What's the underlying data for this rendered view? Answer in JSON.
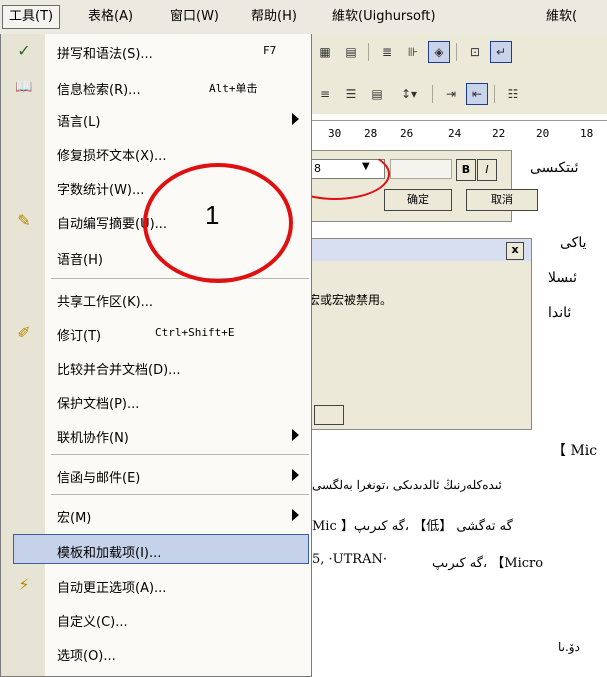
{
  "menubar": {
    "items": [
      "工具(T)",
      "表格(A)",
      "窗口(W)",
      "帮助(H)",
      "維软(Uighursoft)",
      "維软("
    ]
  },
  "ruler": {
    "ticks": [
      "30",
      "28",
      "26",
      "24",
      "22",
      "20",
      "18"
    ]
  },
  "dialog1": {
    "ok": "确定",
    "cancel": "取消",
    "bold": "B",
    "italic": "I",
    "fontsize": "8"
  },
  "dialog2": {
    "text": "宏或宏被禁用。",
    "close": "x"
  },
  "annotation": {
    "number": "1"
  },
  "menu": {
    "items": [
      {
        "label": "拼写和语法(S)...",
        "shortcut": "F7",
        "icon": "spellcheck-icon",
        "glyph": "✓"
      },
      {
        "label": "信息检索(R)...",
        "shortcut": "Alt+单击",
        "icon": "research-icon",
        "glyph": "📖"
      },
      {
        "label": "语言(L)",
        "icon": "",
        "glyph": ""
      },
      {
        "label": "修复损坏文本(X)...",
        "icon": "",
        "glyph": ""
      },
      {
        "label": "字数统计(W)...",
        "icon": "",
        "glyph": ""
      },
      {
        "label": "自动编写摘要(U)...",
        "icon": "autosummary-icon",
        "glyph": "✎"
      },
      {
        "label": "语音(H)",
        "icon": "",
        "glyph": ""
      },
      {
        "label": "共享工作区(K)...",
        "icon": "",
        "glyph": ""
      },
      {
        "label": "修订(T)",
        "shortcut": "Ctrl+Shift+E",
        "icon": "track-changes-icon",
        "glyph": "✐"
      },
      {
        "label": "比较并合并文档(D)...",
        "icon": "",
        "glyph": ""
      },
      {
        "label": "保护文档(P)...",
        "icon": "",
        "glyph": ""
      },
      {
        "label": "联机协作(N)",
        "icon": "",
        "glyph": ""
      },
      {
        "label": "信函与邮件(E)",
        "icon": "",
        "glyph": ""
      },
      {
        "label": "宏(M)",
        "icon": "",
        "glyph": ""
      },
      {
        "label": "模板和加载项(I)...",
        "icon": "",
        "glyph": ""
      },
      {
        "label": "自动更正选项(A)...",
        "icon": "autocorrect-icon",
        "glyph": "⚡"
      },
      {
        "label": "自定义(C)...",
        "icon": "",
        "glyph": ""
      },
      {
        "label": "选项(O)...",
        "icon": "",
        "glyph": ""
      }
    ]
  },
  "doc": {
    "lines": [
      "ئىتكىسى",
      "ياكى",
      "ئىسلا",
      "ئاندا",
      "【 Mic",
      "ئىدەكلەرنىڭ ئالدىدىكى ،تونغرا بەلگسى",
      "Mic 】گە كىرىپ، 【低】 گە تەگشى",
      "5, ·UTRAN·",
      "گە كىرىپ، 【Micro",
      "دۆ.ىا"
    ]
  }
}
